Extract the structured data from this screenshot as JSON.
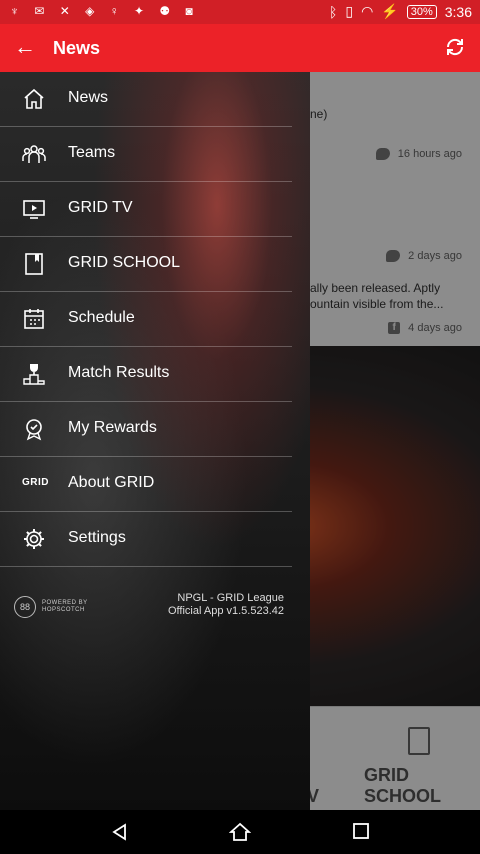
{
  "status_bar": {
    "battery": "30%",
    "time": "3:36"
  },
  "app_bar": {
    "title": "News"
  },
  "feed": [
    {
      "text": "ne)",
      "source": "twitter",
      "time": "16 hours ago"
    },
    {
      "text": "",
      "source": "twitter",
      "time": "2 days ago"
    },
    {
      "text": "ally been released. Aptly\nountain visible from the...",
      "source": "facebook",
      "time": "4 days ago"
    }
  ],
  "bottom_tabs": [
    {
      "label": "TV"
    },
    {
      "label": "GRID SCHOOL"
    }
  ],
  "drawer": {
    "items": [
      {
        "label": "News",
        "icon": "home-icon"
      },
      {
        "label": "Teams",
        "icon": "teams-icon"
      },
      {
        "label": "GRID TV",
        "icon": "tv-icon"
      },
      {
        "label": "GRID SCHOOL",
        "icon": "book-icon"
      },
      {
        "label": "Schedule",
        "icon": "calendar-icon"
      },
      {
        "label": "Match Results",
        "icon": "trophy-podium-icon"
      },
      {
        "label": "My Rewards",
        "icon": "rewards-icon"
      },
      {
        "label": "About GRID",
        "icon": "grid-logo-icon"
      },
      {
        "label": "Settings",
        "icon": "gear-icon"
      }
    ],
    "powered_by": {
      "line1": "POWERED BY",
      "line2": "HOPSCOTCH"
    },
    "app_name": "NPGL - GRID League",
    "app_version": "Official App v1.5.523.42"
  },
  "colors": {
    "primary": "#ec2228",
    "status": "#d11f26"
  }
}
